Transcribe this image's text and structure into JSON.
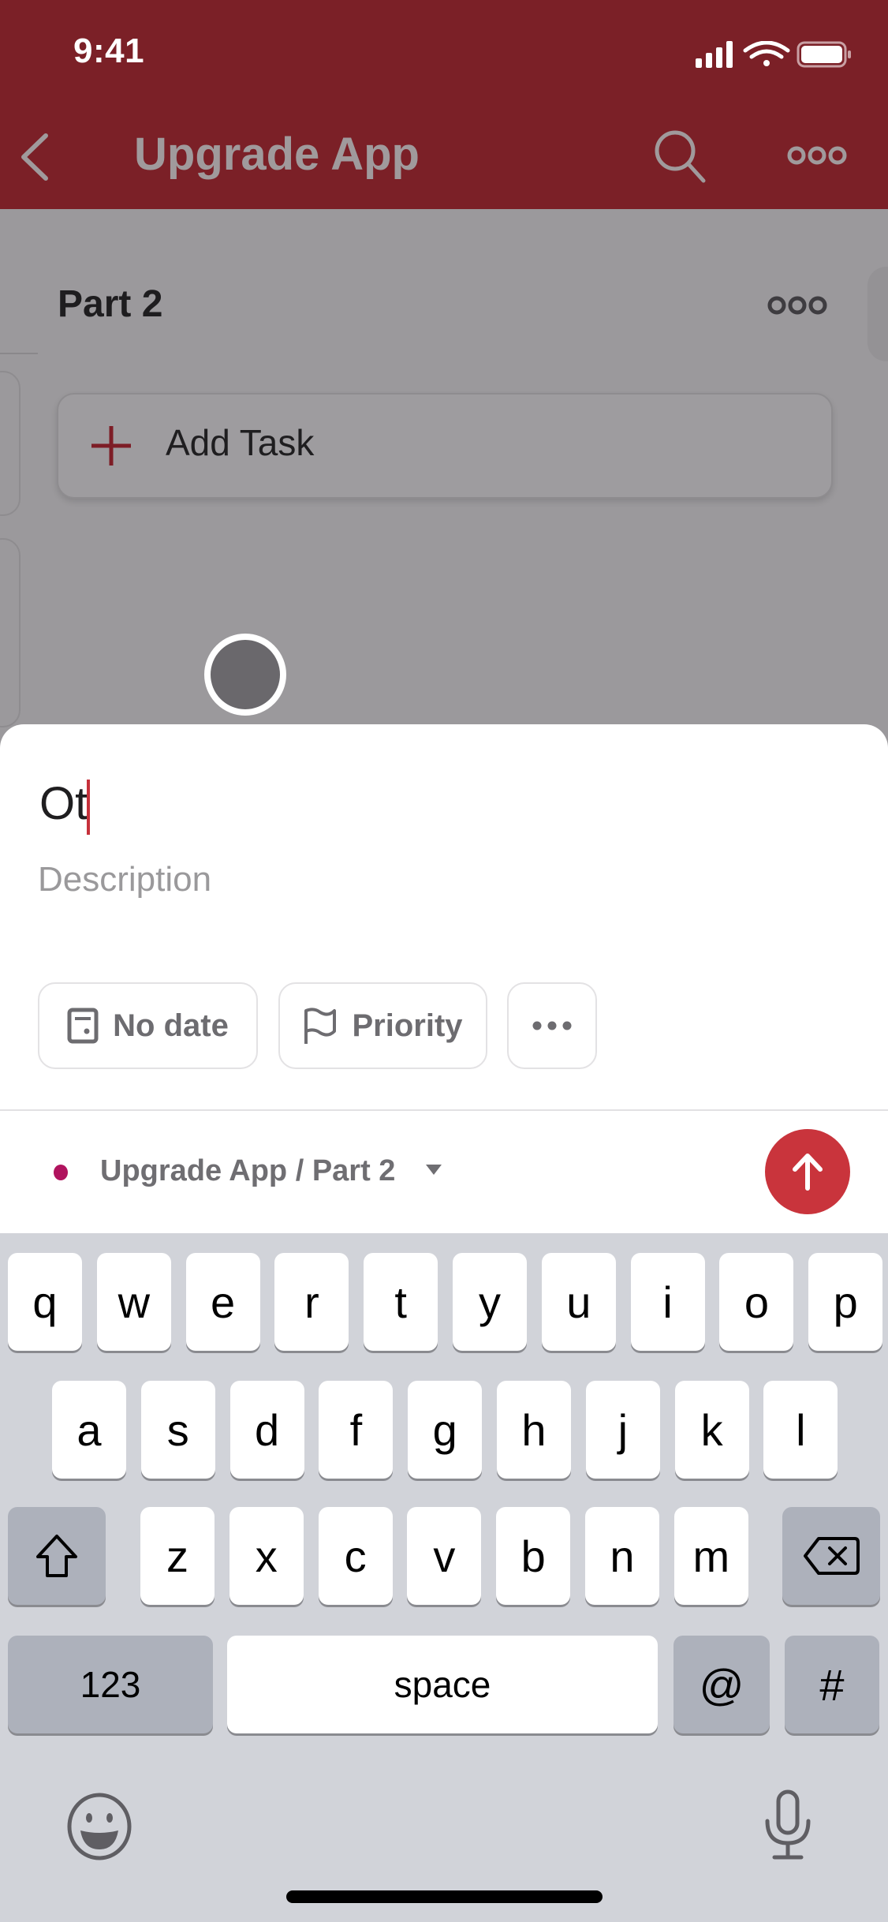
{
  "status_bar": {
    "time": "9:41"
  },
  "header": {
    "title": "Upgrade App",
    "back_icon": "chevron-left-icon",
    "search_icon": "search-icon",
    "more_icon": "more-icon"
  },
  "section": {
    "title": "Part 2",
    "more_icon": "more-icon",
    "add_task_label": "Add Task"
  },
  "composer": {
    "task_name_value": "Ot",
    "description_placeholder": "Description",
    "chips": [
      {
        "label": "No date",
        "icon": "calendar-icon"
      },
      {
        "label": "Priority",
        "icon": "flag-icon"
      },
      {
        "label": "",
        "icon": "more-horizontal-icon"
      }
    ],
    "project_label": "Upgrade App / Part 2",
    "project_color": "#b0135e",
    "send_color": "#c9343c"
  },
  "keyboard": {
    "row1": [
      "q",
      "w",
      "e",
      "r",
      "t",
      "y",
      "u",
      "i",
      "o",
      "p"
    ],
    "row2": [
      "a",
      "s",
      "d",
      "f",
      "g",
      "h",
      "j",
      "k",
      "l"
    ],
    "row3": [
      "z",
      "x",
      "c",
      "v",
      "b",
      "n",
      "m"
    ],
    "numbers_label": "123",
    "space_label": "space",
    "at_label": "@",
    "hash_label": "#"
  }
}
